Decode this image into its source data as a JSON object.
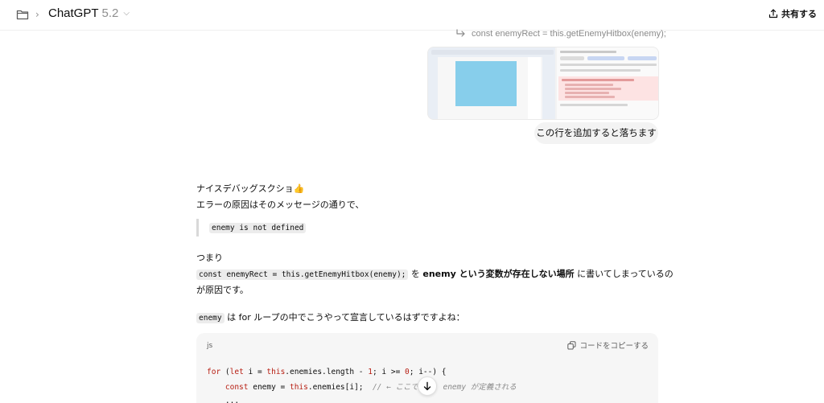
{
  "header": {
    "model_name": "ChatGPT",
    "model_version": "5.2",
    "share_label": "共有する"
  },
  "user_message": {
    "reply_ref": "const enemyRect = this.getEnemyHitbox(enemy);",
    "text": "この行を追加すると落ちます"
  },
  "assistant": {
    "p1": "ナイスデバッグスクショ👍",
    "p2": "エラーの原因はそのメッセージの通りで、",
    "quote_code": "enemy is not defined",
    "p3": "つまり",
    "p4_code": "const enemyRect = this.getEnemyHitbox(enemy);",
    "p4_mid": " を ",
    "p4_bold": "enemy という変数が存在しない場所",
    "p4_tail": " に書いてしまっているの",
    "p5": "が原因です。",
    "p6_code": "enemy",
    "p6_text": " は for ループの中でこうやって宣言しているはずですよね："
  },
  "codeblock": {
    "lang": "js",
    "copy_label": "コードをコピーする",
    "line1_a": "for",
    "line1_b": " (",
    "line1_c": "let",
    "line1_d": " i = ",
    "line1_e": "this",
    "line1_f": ".enemies.length - ",
    "line1_g": "1",
    "line1_h": "; i >= ",
    "line1_i": "0",
    "line1_j": "; i--) {",
    "line2_a": "    ",
    "line2_b": "const",
    "line2_c": " enemy = ",
    "line2_d": "this",
    "line2_e": ".enemies[i];  ",
    "line2_f": "// ← ここで定義  enemy が定義される",
    "line3": "    ..."
  },
  "colors": {
    "keyword": "#b71e12",
    "comment": "#8a8a8a",
    "bubble_bg": "#f3f3f3",
    "code_bg": "#f6f6f6"
  }
}
